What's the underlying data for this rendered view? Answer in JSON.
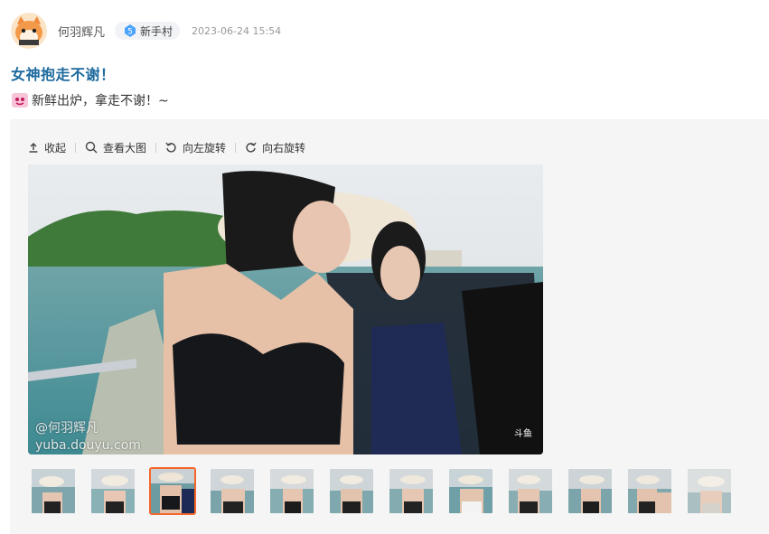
{
  "post": {
    "username": "何羽辉凡",
    "level_number": "5",
    "level_label": "新手村",
    "timestamp": "2023-06-24 15:54",
    "title": "女神抱走不谢！",
    "body_text": "新鲜出炉，拿走不谢！~"
  },
  "gallery": {
    "toolbar": {
      "collapse_label": "收起",
      "view_large_label": "查看大图",
      "rotate_left_label": "向左旋转",
      "rotate_right_label": "向右旋转"
    },
    "watermark_user": "@何羽辉凡",
    "watermark_site": "yuba.douyu.com",
    "logo_text": "斗鱼",
    "active_thumb_index": 2,
    "thumb_count": 12
  },
  "colors": {
    "title": "#1d6a9e",
    "active_border": "#f5662a",
    "gallery_bg": "#f5f5f5",
    "badge_bg": "#f1f3f6",
    "level_icon": "#4aa3ff"
  },
  "icons": {
    "collapse": "upload-arrow-icon",
    "view_large": "magnifier-icon",
    "rotate_left": "rotate-left-icon",
    "rotate_right": "rotate-right-icon",
    "level": "diamond-level-icon"
  }
}
